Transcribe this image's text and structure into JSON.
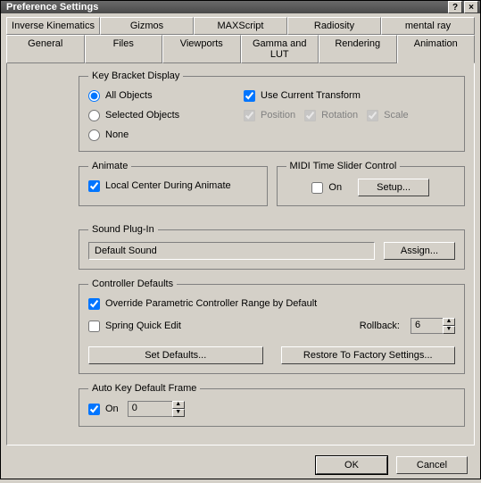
{
  "window": {
    "title": "Preference Settings",
    "help_btn": "?",
    "close_btn": "×"
  },
  "tabs": {
    "row1": [
      "Inverse Kinematics",
      "Gizmos",
      "MAXScript",
      "Radiosity",
      "mental ray"
    ],
    "row2": [
      "General",
      "Files",
      "Viewports",
      "Gamma and LUT",
      "Rendering",
      "Animation"
    ]
  },
  "kbd": {
    "legend": "Key Bracket Display",
    "all_objects": "All Objects",
    "selected_objects": "Selected Objects",
    "none": "None",
    "use_current": "Use Current Transform",
    "position": "Position",
    "rotation": "Rotation",
    "scale": "Scale"
  },
  "animate": {
    "legend": "Animate",
    "local_center": "Local Center During Animate"
  },
  "midi": {
    "legend": "MIDI Time Slider Control",
    "on": "On",
    "setup": "Setup..."
  },
  "sound": {
    "legend": "Sound Plug-In",
    "value": "Default Sound",
    "assign": "Assign..."
  },
  "ctrl": {
    "legend": "Controller Defaults",
    "override": "Override Parametric Controller Range by Default",
    "spring": "Spring Quick Edit",
    "rollback": "Rollback:",
    "rollback_value": "6",
    "set_defaults": "Set Defaults...",
    "restore": "Restore To Factory Settings..."
  },
  "autokey": {
    "legend": "Auto Key Default Frame",
    "on": "On",
    "value": "0"
  },
  "footer": {
    "ok": "OK",
    "cancel": "Cancel"
  }
}
